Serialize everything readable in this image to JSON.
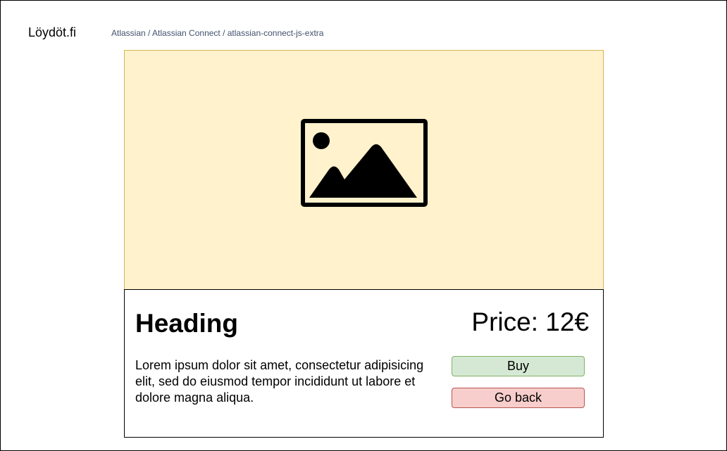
{
  "header": {
    "logo": "Löydöt.fi",
    "breadcrumb": "Atlassian / Atlassian Connect / atlassian-connect-js-extra"
  },
  "product": {
    "image_icon": "image-placeholder-icon",
    "heading": "Heading",
    "price": "Price: 12€",
    "description": "Lorem ipsum dolor sit amet, consectetur adipisicing elit, sed do eiusmod tempor incididunt ut labore et dolore magna aliqua.",
    "buy_label": "Buy",
    "back_label": "Go back"
  },
  "colors": {
    "image_bg": "#fff2cc",
    "image_border": "#d6b656",
    "buy_bg": "#d5e8d4",
    "buy_border": "#82b366",
    "back_bg": "#f8cecc",
    "back_border": "#b85450",
    "breadcrumb_text": "#42526e"
  }
}
